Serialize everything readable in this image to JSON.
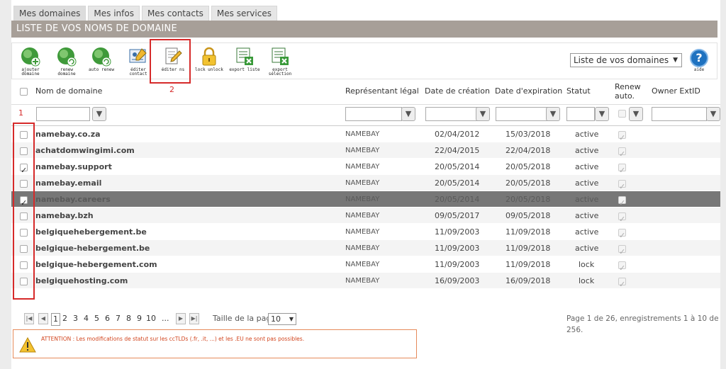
{
  "tabs": [
    "Mes domaines",
    "Mes infos",
    "Mes contacts",
    "Mes services"
  ],
  "title": "LISTE DE VOS NOMS DE DOMAINE",
  "toolbar": {
    "buttons": [
      {
        "label": "ajouter domaine"
      },
      {
        "label": "renew domaine"
      },
      {
        "label": "auto renew"
      },
      {
        "label": "éditer contact"
      },
      {
        "label": "éditer ns"
      },
      {
        "label": "lock unlock"
      },
      {
        "label": "export liste"
      },
      {
        "label": "export sélection"
      }
    ],
    "select_value": "Liste de vos domaines",
    "help_label": "aide"
  },
  "annotations": {
    "one": "1",
    "two": "2"
  },
  "headers": {
    "domain": "Nom de domaine",
    "rep": "Représentant légal",
    "created": "Date de création",
    "expires": "Date d'expiration",
    "status": "Statut",
    "renew": "Renew auto.",
    "owner": "Owner ExtID"
  },
  "rows": [
    {
      "domain": "namebay.co.za",
      "rep": "NAMEBAY",
      "created": "02/04/2012",
      "expires": "15/03/2018",
      "status": "active",
      "checked": false,
      "selected": false
    },
    {
      "domain": "achatdomwingimi.com",
      "rep": "NAMEBAY",
      "created": "22/04/2015",
      "expires": "22/04/2018",
      "status": "active",
      "checked": false,
      "selected": false
    },
    {
      "domain": "namebay.support",
      "rep": "NAMEBAY",
      "created": "20/05/2014",
      "expires": "20/05/2018",
      "status": "active",
      "checked": true,
      "selected": false
    },
    {
      "domain": "namebay.email",
      "rep": "NAMEBAY",
      "created": "20/05/2014",
      "expires": "20/05/2018",
      "status": "active",
      "checked": false,
      "selected": false
    },
    {
      "domain": "namebay.careers",
      "rep": "NAMEBAY",
      "created": "20/05/2014",
      "expires": "20/05/2018",
      "status": "active",
      "checked": true,
      "selected": true
    },
    {
      "domain": "namebay.bzh",
      "rep": "NAMEBAY",
      "created": "09/05/2017",
      "expires": "09/05/2018",
      "status": "active",
      "checked": false,
      "selected": false
    },
    {
      "domain": "belgiquehebergement.be",
      "rep": "NAMEBAY",
      "created": "11/09/2003",
      "expires": "11/09/2018",
      "status": "active",
      "checked": false,
      "selected": false
    },
    {
      "domain": "belgique-hebergement.be",
      "rep": "NAMEBAY",
      "created": "11/09/2003",
      "expires": "11/09/2018",
      "status": "active",
      "checked": false,
      "selected": false
    },
    {
      "domain": "belgique-hebergement.com",
      "rep": "NAMEBAY",
      "created": "11/09/2003",
      "expires": "11/09/2018",
      "status": "lock",
      "checked": false,
      "selected": false
    },
    {
      "domain": "belgiquehosting.com",
      "rep": "NAMEBAY",
      "created": "16/09/2003",
      "expires": "16/09/2018",
      "status": "lock",
      "checked": false,
      "selected": false
    }
  ],
  "pager": {
    "pages": [
      "1",
      "2",
      "3",
      "4",
      "5",
      "6",
      "7",
      "8",
      "9",
      "10",
      "..."
    ],
    "size_label": "Taille de la page:",
    "size_value": "10",
    "summary": "Page 1 de 26, enregistrements 1 à 10 de 256."
  },
  "warning": "ATTENTION : Les modifications de statut sur les ccTLDs (.fr, .it, ...) et les .EU ne sont pas possibles."
}
